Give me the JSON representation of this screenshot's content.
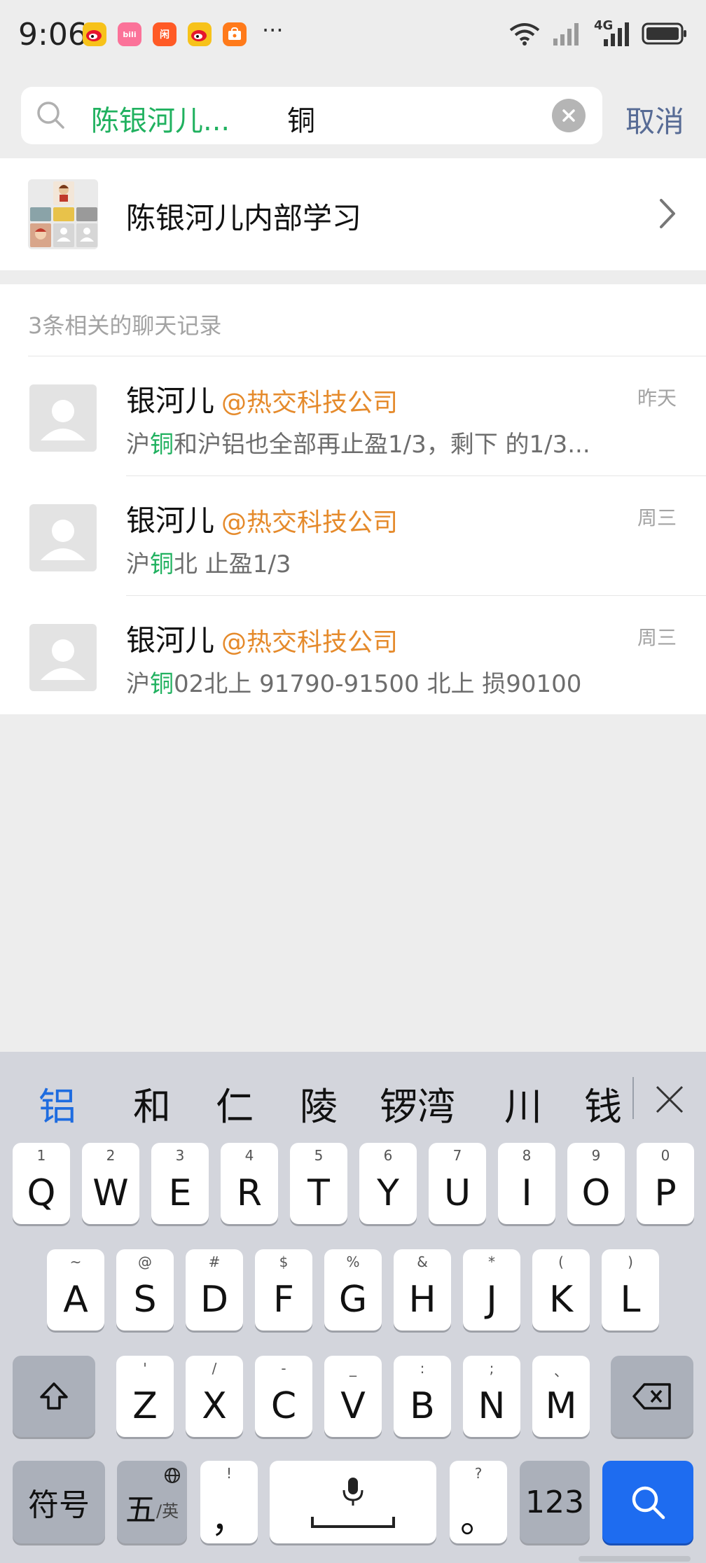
{
  "status_bar": {
    "time": "9:06",
    "app_icons": [
      {
        "name": "weibo-icon",
        "color": "#f7c21a"
      },
      {
        "name": "bilibili-icon",
        "color": "#fb7299",
        "label": "bili"
      },
      {
        "name": "xianyu-icon",
        "color": "#ff5a26",
        "label": "闲"
      },
      {
        "name": "weibo-icon",
        "color": "#f7c21a"
      },
      {
        "name": "store-icon",
        "color": "#ff7a1a"
      }
    ],
    "more": "···",
    "network_label": "4G"
  },
  "search": {
    "chip_label": "陈银河儿...",
    "query": "铜",
    "cancel_label": "取消"
  },
  "group_result": {
    "name": "陈银河儿内部学习"
  },
  "records": {
    "header": "3条相关的聊天记录",
    "items": [
      {
        "sender": "银河儿",
        "company": "@热交科技公司",
        "time": "昨天",
        "msg_prefix": "沪",
        "msg_highlight": "铜",
        "msg_suffix": "和沪铝也全部再止盈1/3，剩下 的1/3..."
      },
      {
        "sender": "银河儿",
        "company": "@热交科技公司",
        "time": "周三",
        "msg_prefix": "沪",
        "msg_highlight": "铜",
        "msg_suffix": "北 止盈1/3"
      },
      {
        "sender": "银河儿",
        "company": "@热交科技公司",
        "time": "周三",
        "msg_prefix": "沪",
        "msg_highlight": "铜",
        "msg_suffix": "02北上  91790-91500 北上  损90100"
      }
    ]
  },
  "keyboard": {
    "candidates": [
      "铝",
      "和",
      "仁",
      "陵",
      "锣湾",
      "川",
      "钱"
    ],
    "row1": [
      {
        "key": "Q",
        "hint": "1"
      },
      {
        "key": "W",
        "hint": "2"
      },
      {
        "key": "E",
        "hint": "3"
      },
      {
        "key": "R",
        "hint": "4"
      },
      {
        "key": "T",
        "hint": "5"
      },
      {
        "key": "Y",
        "hint": "6"
      },
      {
        "key": "U",
        "hint": "7"
      },
      {
        "key": "I",
        "hint": "8"
      },
      {
        "key": "O",
        "hint": "9"
      },
      {
        "key": "P",
        "hint": "0"
      }
    ],
    "row2": [
      {
        "key": "A",
        "hint": "~"
      },
      {
        "key": "S",
        "hint": "@"
      },
      {
        "key": "D",
        "hint": "#"
      },
      {
        "key": "F",
        "hint": "$"
      },
      {
        "key": "G",
        "hint": "%"
      },
      {
        "key": "H",
        "hint": "&"
      },
      {
        "key": "J",
        "hint": "*"
      },
      {
        "key": "K",
        "hint": "("
      },
      {
        "key": "L",
        "hint": ")"
      }
    ],
    "row3": [
      {
        "key": "Z",
        "hint": "'"
      },
      {
        "key": "X",
        "hint": "/"
      },
      {
        "key": "C",
        "hint": "-"
      },
      {
        "key": "V",
        "hint": "_"
      },
      {
        "key": "B",
        "hint": ":"
      },
      {
        "key": "N",
        "hint": ";"
      },
      {
        "key": "M",
        "hint": "、"
      }
    ],
    "symbols_label": "符号",
    "wubi_label": "五",
    "wubi_sub": "/英",
    "comma_key": "，",
    "comma_hint": "!",
    "period_key": "。",
    "period_hint": "?",
    "num_label": "123"
  }
}
